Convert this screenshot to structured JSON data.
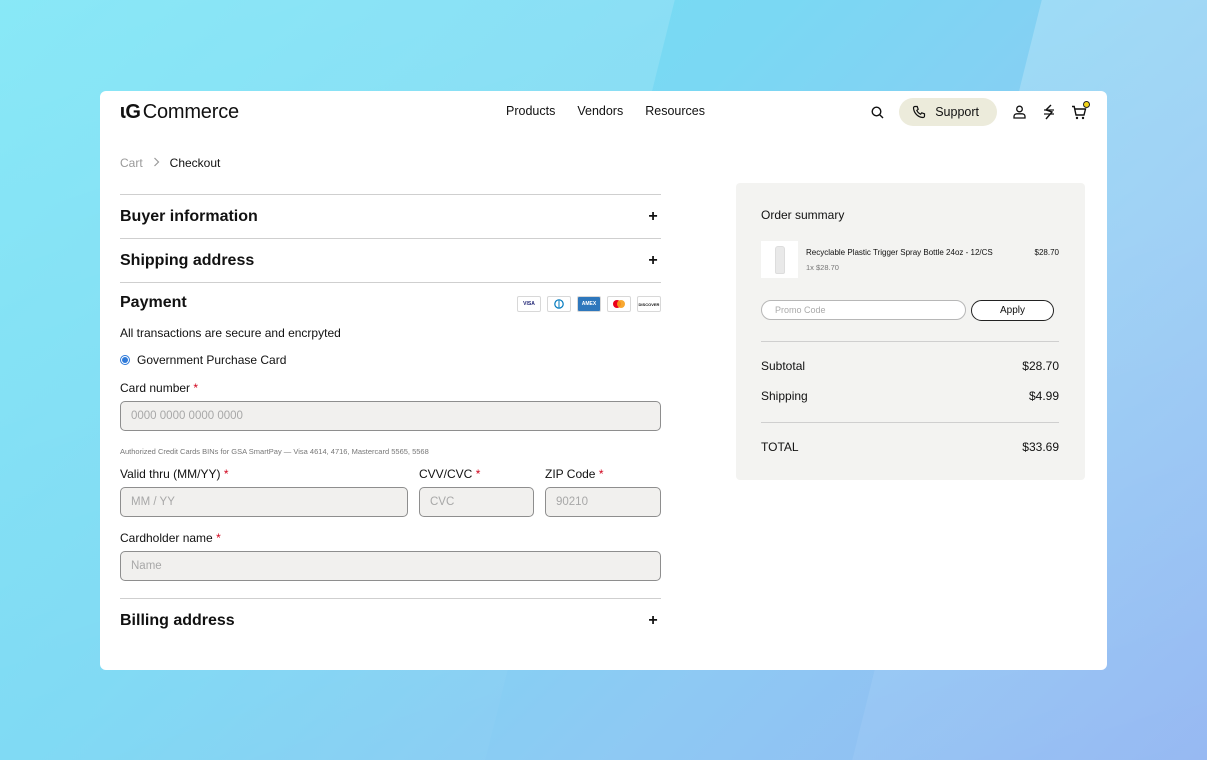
{
  "header": {
    "logo_mark": "ɩG",
    "logo_text": "Commerce",
    "nav": [
      "Products",
      "Vendors",
      "Resources"
    ],
    "support_label": "Support",
    "icons": [
      "search-icon",
      "phone-icon",
      "user-icon",
      "currency-icon",
      "cart-icon"
    ]
  },
  "breadcrumb": {
    "items": [
      "Cart",
      "Checkout"
    ]
  },
  "sections": {
    "buyer": "Buyer information",
    "shipping": "Shipping address",
    "payment": "Payment",
    "billing": "Billing address"
  },
  "payment": {
    "card_brands": [
      "VISA",
      "DINERS",
      "AMEX",
      "MASTERCARD",
      "DISCOVER"
    ],
    "secure_text": "All transactions are secure and encrpyted",
    "method_label": "Government Purchase Card",
    "card_number_label": "Card number",
    "card_number_placeholder": "0000 0000 0000 0000",
    "hint": "Authorized Credit Cards BINs for GSA SmartPay — Visa 4614, 4716, Mastercard 5565, 5568",
    "valid_label": "Valid thru (MM/YY)",
    "valid_placeholder": "MM / YY",
    "cvv_label": "CVV/CVC",
    "cvv_placeholder": "CVC",
    "zip_label": "ZIP Code",
    "zip_placeholder": "90210",
    "name_label": "Cardholder name",
    "name_placeholder": "Name",
    "required_mark": "*"
  },
  "summary": {
    "title": "Order summary",
    "item_name": "Recyclable Plastic Trigger Spray Bottle 24oz - 12/CS",
    "item_qty": "1x $28.70",
    "item_price": "$28.70",
    "promo_placeholder": "Promo Code",
    "apply_label": "Apply",
    "subtotal_label": "Subtotal",
    "subtotal_value": "$28.70",
    "shipping_label": "Shipping",
    "shipping_value": "$4.99",
    "total_label": "TOTAL",
    "total_value": "$33.69"
  },
  "colors": {
    "accent_blue": "#2f7ad9",
    "support_bg": "#ecebdb",
    "required": "#d0021b"
  }
}
